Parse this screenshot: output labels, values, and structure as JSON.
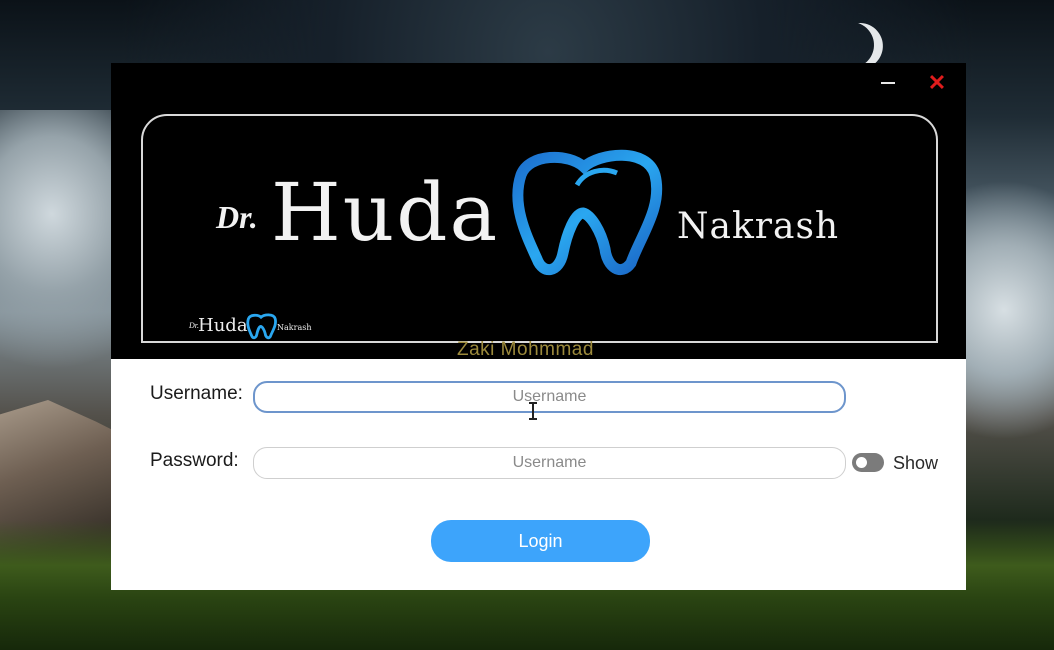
{
  "window": {
    "minimize_label": "–",
    "close_label": "✕",
    "accent_color": "#3da4fb",
    "close_color": "#e01c1c"
  },
  "banner": {
    "prefix": "Dr.",
    "name": "Huda",
    "surname": "Nakrash",
    "logo_icon": "tooth-icon",
    "mini_prefix": "Dr.",
    "mini_name": "Huda",
    "mini_surname": "Nakrash"
  },
  "watermark": "Zaki Mohmmad",
  "form": {
    "username_label": "Username:",
    "username_value": "",
    "username_placeholder": "Username",
    "password_label": "Password:",
    "password_value": "",
    "password_placeholder": "Username",
    "show_label": "Show",
    "show_toggle_on": false,
    "login_label": "Login"
  }
}
